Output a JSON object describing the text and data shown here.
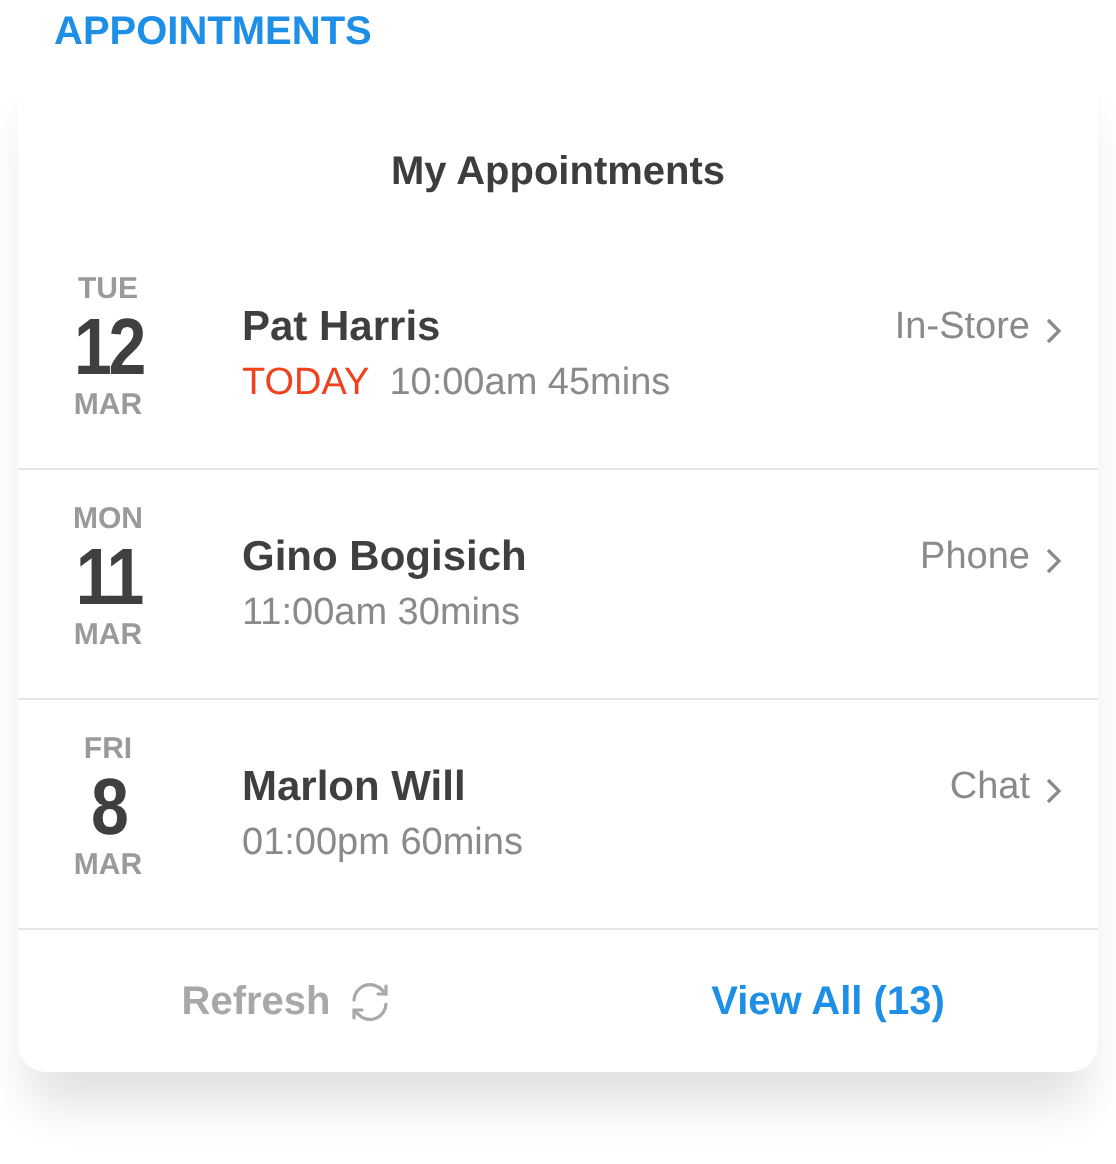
{
  "section_title": "APPOINTMENTS",
  "card": {
    "title": "My Appointments",
    "appointments": [
      {
        "weekday": "TUE",
        "day": "12",
        "month": "MAR",
        "name": "Pat Harris",
        "flag": "TODAY",
        "time": "10:00am 45mins",
        "channel": "In-Store"
      },
      {
        "weekday": "MON",
        "day": "11",
        "month": "MAR",
        "name": "Gino Bogisich",
        "time": "11:00am 30mins",
        "channel": "Phone"
      },
      {
        "weekday": "FRI",
        "day": "8",
        "month": "MAR",
        "name": "Marlon Will",
        "time": "01:00pm 60mins",
        "channel": "Chat"
      }
    ],
    "refresh": "Refresh",
    "view_all": "View All (13)"
  }
}
